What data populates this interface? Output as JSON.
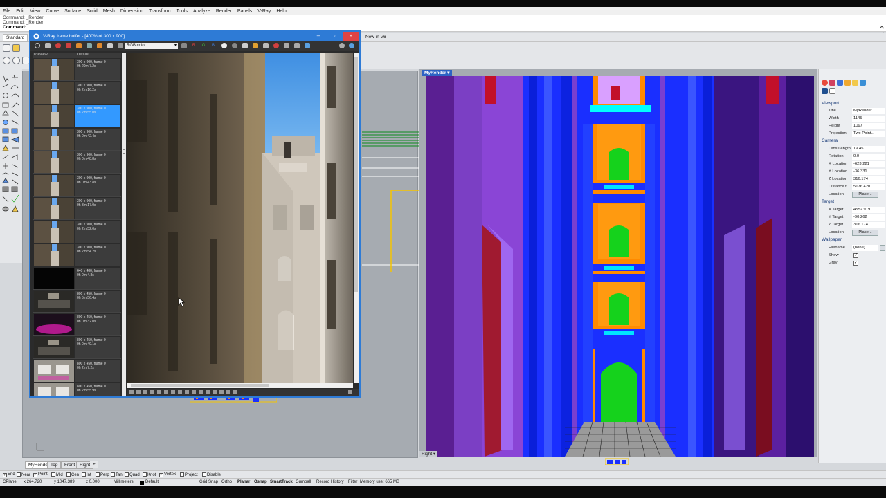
{
  "menu": [
    "File",
    "Edit",
    "View",
    "Curve",
    "Surface",
    "Solid",
    "Mesh",
    "Dimension",
    "Transform",
    "Tools",
    "Analyze",
    "Render",
    "Panels",
    "V-Ray",
    "Help"
  ],
  "command_history": [
    "Command: _Render",
    "Command: _Render"
  ],
  "command_prompt": "Command:",
  "toolbar_tabs": {
    "standard": "Standard",
    "new_v6": "New in V6"
  },
  "vfb": {
    "title": "V-Ray frame buffer - [400% of 300 x 900]",
    "channel": "RGB color",
    "history_headers": [
      "Preview",
      "Details"
    ],
    "history": [
      {
        "res": "300 x 900, frame 0",
        "time": "0h 20m 7.2s",
        "thumb": "street"
      },
      {
        "res": "300 x 900, frame 0",
        "time": "0h 2m 16.2s",
        "thumb": "street"
      },
      {
        "res": "300 x 900, frame 0",
        "time": "0h 2m 55.0s",
        "thumb": "street",
        "selected": true
      },
      {
        "res": "300 x 900, frame 0",
        "time": "0h 0m 42.4s",
        "thumb": "street"
      },
      {
        "res": "300 x 900, frame 0",
        "time": "0h 0m 48.8s",
        "thumb": "street"
      },
      {
        "res": "300 x 900, frame 0",
        "time": "0h 0m 43.8s",
        "thumb": "street"
      },
      {
        "res": "300 x 900, frame 0",
        "time": "0h 3m 17.0s",
        "thumb": "street"
      },
      {
        "res": "300 x 900, frame 0",
        "time": "0h 2m 52.0s",
        "thumb": "street"
      },
      {
        "res": "300 x 900, frame 0",
        "time": "0h 2m 54.2s",
        "thumb": "street"
      },
      {
        "res": "640 x 480, frame 0",
        "time": "0h 0m 4.8s",
        "thumb": "black"
      },
      {
        "res": "800 x 450, frame 0",
        "time": "0h 5m 56.4s",
        "thumb": "interior"
      },
      {
        "res": "800 x 450, frame 0",
        "time": "0h 0m 32.0s",
        "thumb": "pink"
      },
      {
        "res": "800 x 450, frame 0",
        "time": "0h 0m 49.1s",
        "thumb": "interior"
      },
      {
        "res": "800 x 450, frame 0",
        "time": "0h 2m 7.2s",
        "thumb": "bright"
      },
      {
        "res": "800 x 450, frame 0",
        "time": "0h 2m 55.9s",
        "thumb": "bright"
      }
    ]
  },
  "viewport_right": {
    "title": "MyRender",
    "label": "Right"
  },
  "properties": {
    "sections": {
      "viewport": "Viewport",
      "camera": "Camera",
      "target": "Target",
      "wallpaper": "Wallpaper"
    },
    "viewport": {
      "title": [
        "Title",
        "MyRender"
      ],
      "width": [
        "Width",
        "1145"
      ],
      "height": [
        "Height",
        "1097"
      ],
      "projection": [
        "Projection",
        "Two Point..."
      ]
    },
    "camera": {
      "lens": [
        "Lens Length",
        "19.45"
      ],
      "rotation": [
        "Rotation",
        "0.0"
      ],
      "x": [
        "X Location",
        "-623.221"
      ],
      "y": [
        "Y Location",
        "-36.331"
      ],
      "z": [
        "Z Location",
        "316.174"
      ],
      "distance": [
        "Distance t...",
        "5176.420"
      ],
      "location": [
        "Location",
        "Place..."
      ]
    },
    "target": {
      "x": [
        "X Target",
        "4552.919"
      ],
      "y": [
        "Y Target",
        "-90.262"
      ],
      "z": [
        "Z Target",
        "316.174"
      ],
      "location": [
        "Location",
        "Place..."
      ]
    },
    "wallpaper": {
      "filename": [
        "Filename",
        "(none)"
      ],
      "show": "Show",
      "gray": "Gray"
    }
  },
  "viewport_tabs": [
    "MyRender",
    "Top",
    "Front",
    "Right"
  ],
  "osnaps": [
    {
      "label": "End",
      "checked": true
    },
    {
      "label": "Near",
      "checked": false
    },
    {
      "label": "Point",
      "checked": true
    },
    {
      "label": "Mid",
      "checked": false
    },
    {
      "label": "Cen",
      "checked": false
    },
    {
      "label": "Int",
      "checked": false
    },
    {
      "label": "Perp",
      "checked": false
    },
    {
      "label": "Tan",
      "checked": false
    },
    {
      "label": "Quad",
      "checked": false
    },
    {
      "label": "Knot",
      "checked": false
    },
    {
      "label": "Vertex",
      "checked": true
    },
    {
      "label": "Project",
      "checked": false
    },
    {
      "label": "Disable",
      "checked": false
    }
  ],
  "status": {
    "cplane": "CPlane",
    "x": "x 264.720",
    "y": "y 1047.389",
    "z": "z 0.000",
    "units": "Millimeters",
    "layer": "Default",
    "grid_snap": "Grid Snap",
    "ortho": "Ortho",
    "planar": "Planar",
    "osnap": "Osnap",
    "smarttrack": "SmartTrack",
    "gumball": "Gumball",
    "record_history": "Record History",
    "filter": "Filter",
    "memory": "Memory use: 665 MB"
  },
  "colors": {
    "vray_blue": "#2e7bd6",
    "purple": "#7b3fc4",
    "blue": "#0a2cff",
    "orange": "#ff8a00",
    "green": "#15d21c"
  }
}
